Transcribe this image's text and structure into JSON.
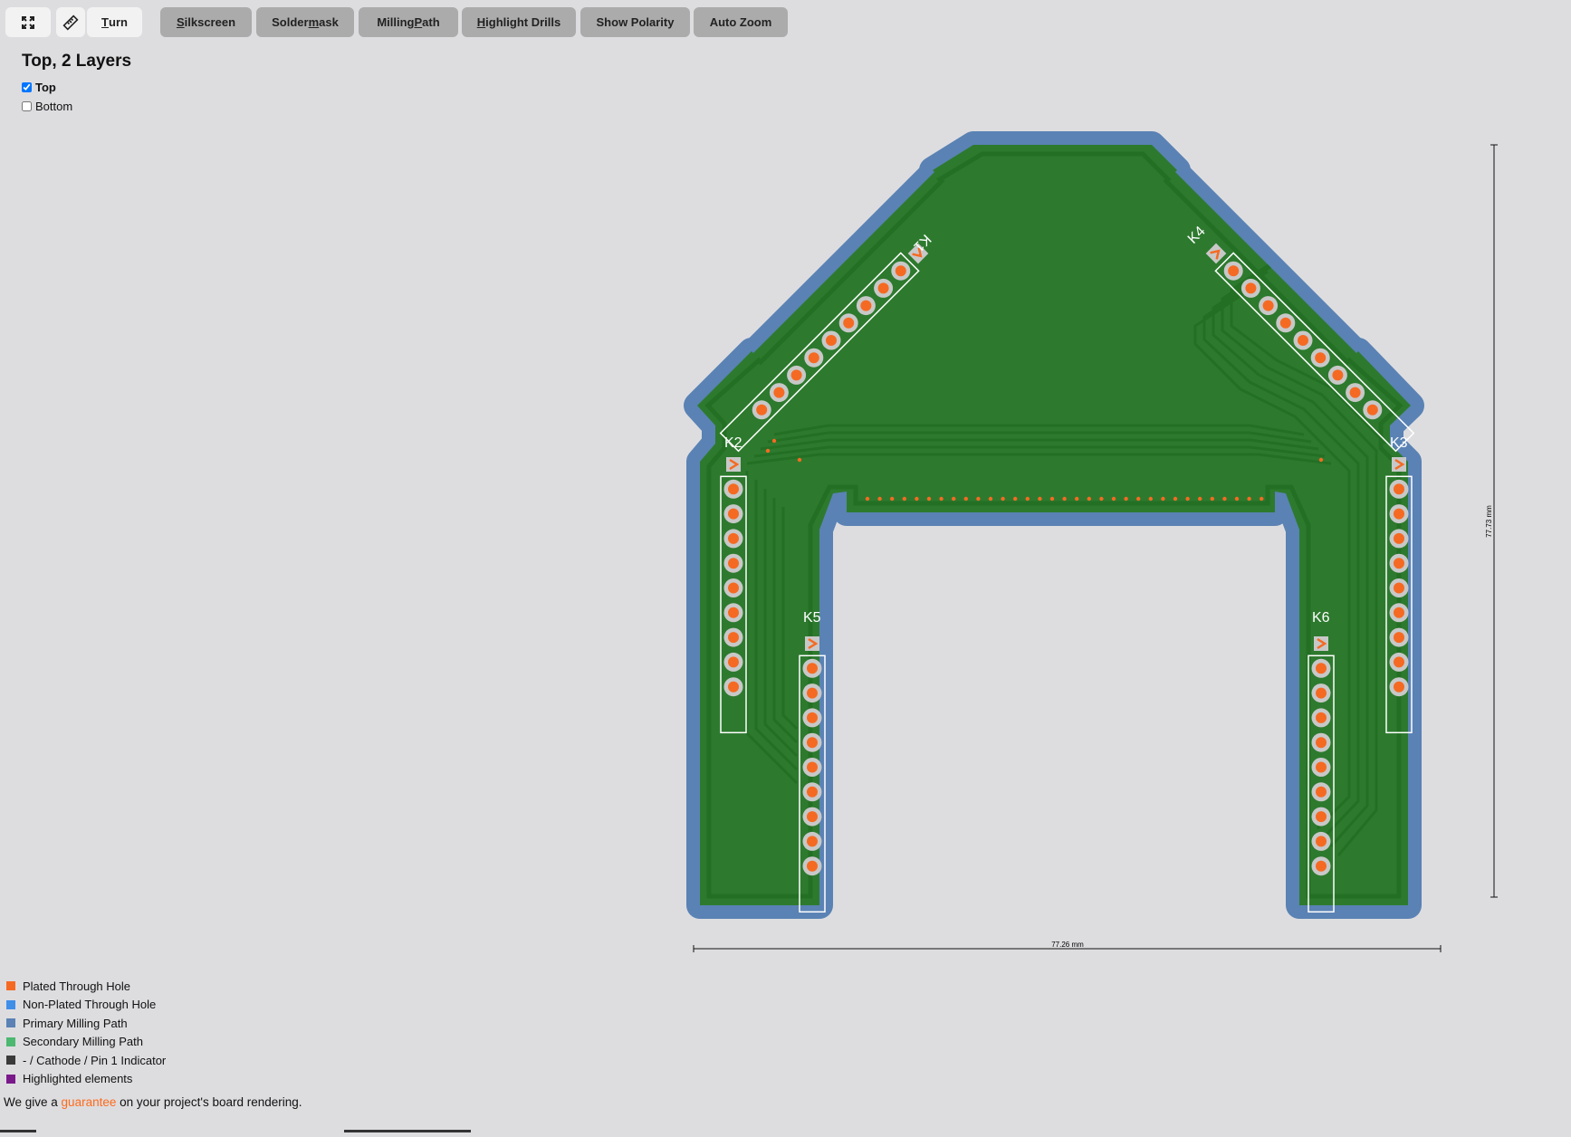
{
  "toolbar": {
    "fullscreen_icon": "fullscreen-icon",
    "ruler_icon": "ruler-icon",
    "buttons": [
      {
        "label_pre": "",
        "label_u": "T",
        "label_post": "urn",
        "active": true
      },
      {
        "label_pre": "",
        "label_u": "S",
        "label_post": "ilkscreen",
        "active": false
      },
      {
        "label_pre": "Solder",
        "label_u": "m",
        "label_post": "ask",
        "active": false
      },
      {
        "label_pre": "Milling ",
        "label_u": "P",
        "label_post": "ath",
        "active": false
      },
      {
        "label_pre": "",
        "label_u": "H",
        "label_post": "ighlight Drills",
        "active": false
      },
      {
        "label_pre": "Show Polarity",
        "label_u": "",
        "label_post": "",
        "active": false
      },
      {
        "label_pre": "Auto Zoom",
        "label_u": "",
        "label_post": "",
        "active": false
      }
    ]
  },
  "view": {
    "title": "Top, 2 Layers",
    "layers": [
      {
        "label": "Top",
        "checked": true
      },
      {
        "label": "Bottom",
        "checked": false
      }
    ]
  },
  "board": {
    "components": [
      "K1",
      "K2",
      "K3",
      "K4",
      "K5",
      "K6"
    ],
    "pins_per_header": 10,
    "width_label": "77.26 mm",
    "height_label": "77.73 mm",
    "colors": {
      "background": "#dddde0",
      "milling": "#5a82b4",
      "board": "#2d7a2e",
      "trace": "#237024",
      "pad": "#c8c8c8",
      "drill": "#f56a22",
      "silkscreen": "#ffffff"
    }
  },
  "legend": [
    {
      "label": "Plated Through Hole",
      "color": "#f56a22"
    },
    {
      "label": "Non-Plated Through Hole",
      "color": "#3f8ee8"
    },
    {
      "label": "Primary Milling Path",
      "color": "#5a82b4"
    },
    {
      "label": "Secondary Milling Path",
      "color": "#4cb870"
    },
    {
      "label": "- / Cathode / Pin 1 Indicator",
      "color": "#3a3a3a"
    },
    {
      "label": "Highlighted elements",
      "color": "#7a1a8a"
    }
  ],
  "footer": {
    "prefix": "We give a ",
    "link": "guarantee",
    "suffix": " on your project's board rendering."
  }
}
